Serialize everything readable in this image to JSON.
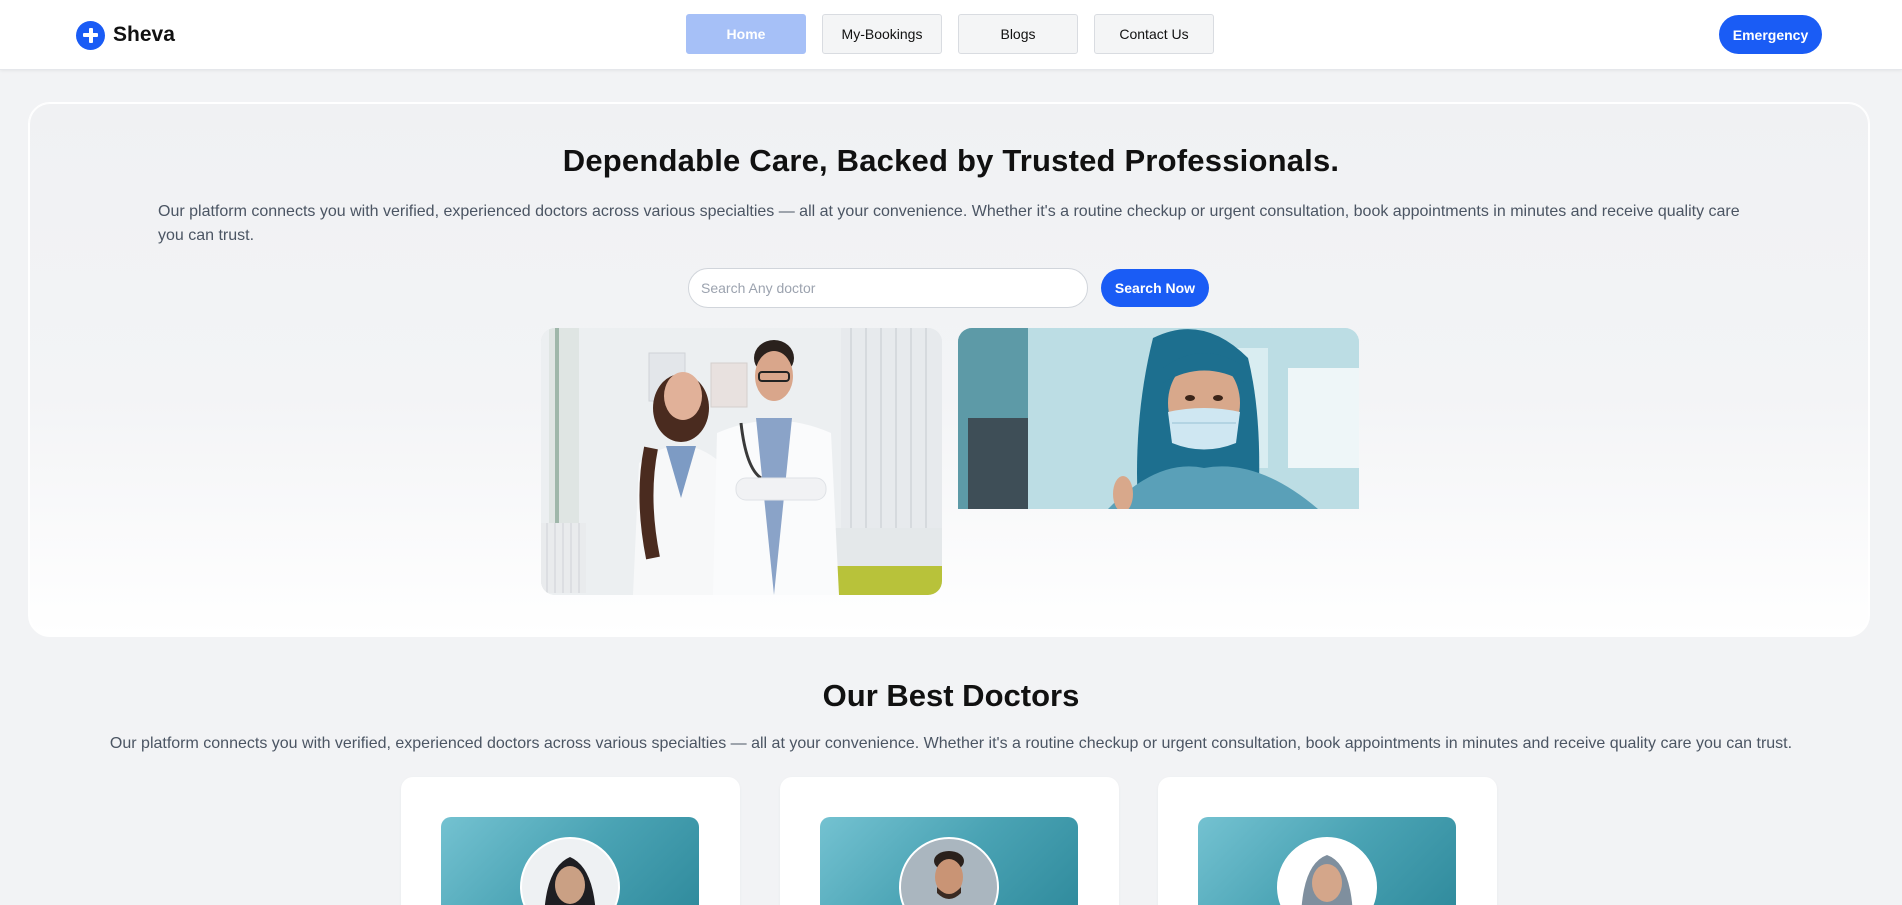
{
  "brand": {
    "name": "Sheva",
    "icon": "medical-cross-icon",
    "color": "#1a5cf5"
  },
  "nav": {
    "items": [
      {
        "label": "Home",
        "active": true
      },
      {
        "label": "My-Bookings",
        "active": false
      },
      {
        "label": "Blogs",
        "active": false
      },
      {
        "label": "Contact Us",
        "active": false
      }
    ],
    "emergency_label": "Emergency"
  },
  "hero": {
    "title": "Dependable Care, Backed by Trusted Professionals.",
    "description": "Our platform connects you with verified, experienced doctors across various specialties — all at your convenience. Whether it's a routine checkup or urgent consultation, book appointments in minutes and receive quality care you can trust.",
    "search_placeholder": "Search Any doctor",
    "search_button": "Search Now"
  },
  "doctors_section": {
    "title": "Our Best Doctors",
    "description": "Our platform connects you with verified, experienced doctors across various specialties — all at your convenience. Whether it's a routine checkup or urgent consultation, book appointments in minutes and receive quality care you can trust.",
    "cards": [
      {
        "avatar": "female-doctor-hijab"
      },
      {
        "avatar": "male-doctor"
      },
      {
        "avatar": "female-doctor-hijab"
      }
    ]
  },
  "colors": {
    "primary": "#1a5cf5",
    "nav_active": "#a6c0f7",
    "background": "#f2f3f5",
    "card_banner": "#4aa3b4"
  }
}
